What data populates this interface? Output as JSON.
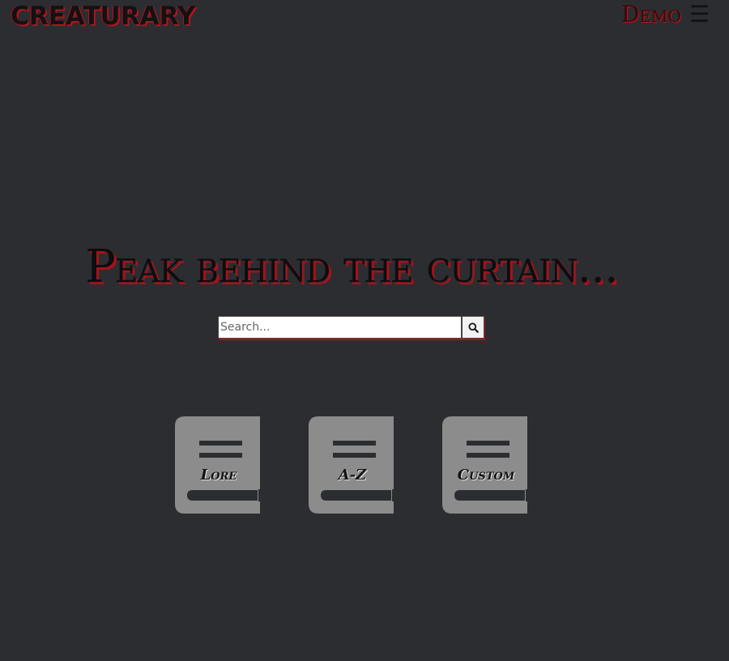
{
  "header": {
    "logo_text": "CREATURARY",
    "demo_label": "Demo",
    "menu_icon": "☰"
  },
  "hero": {
    "title": "Peak behind the curtain..."
  },
  "search": {
    "placeholder": "Search...",
    "value": "",
    "button_icon": "search-icon"
  },
  "books": [
    {
      "label": "Lore",
      "icon": "book-icon"
    },
    {
      "label": "A-Z",
      "icon": "book-icon"
    },
    {
      "label": "Custom",
      "icon": "book-icon"
    }
  ],
  "colors": {
    "background": "#2c2d30",
    "accent_red": "#a5121b",
    "book_grey": "#8c8c8c",
    "book_dark": "#2c2d30"
  }
}
